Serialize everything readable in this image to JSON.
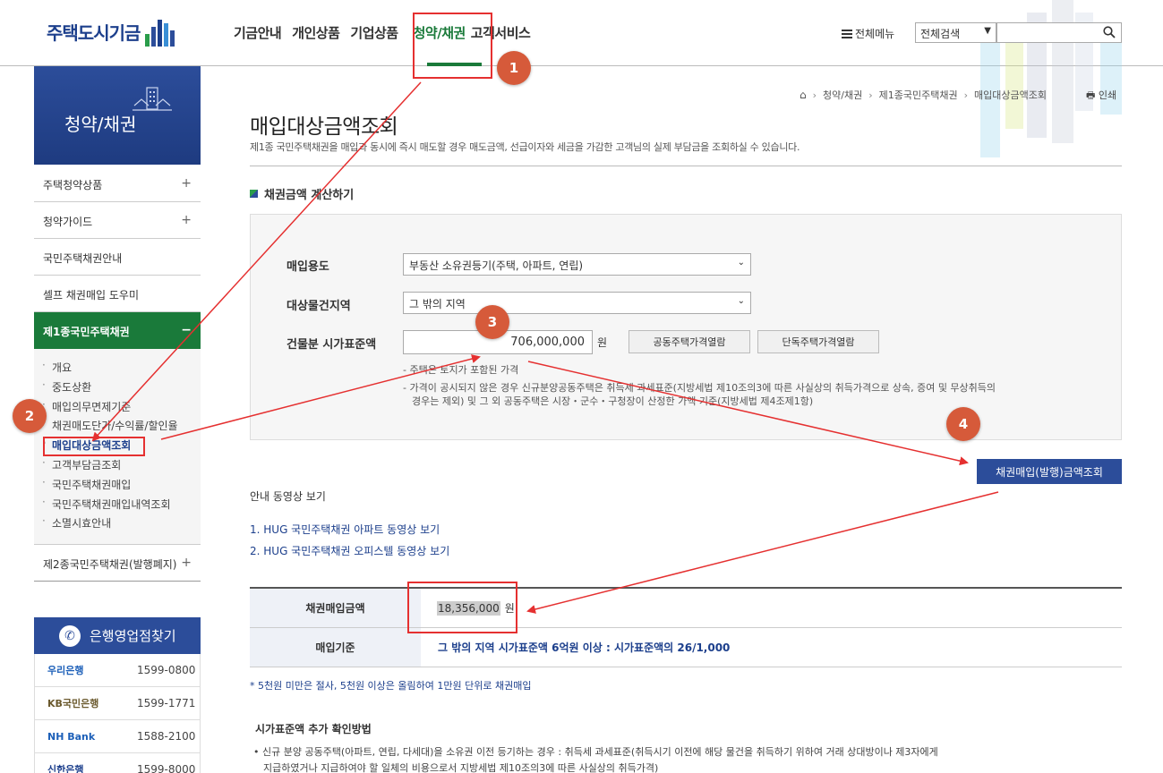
{
  "header": {
    "logo_text": "주택도시기금",
    "nav": [
      "기금안내",
      "개인상품",
      "기업상품",
      "청약/채권",
      "고객서비스"
    ],
    "all_menu_label": "전체메뉴",
    "search_scope": "전체검색",
    "search_placeholder": ""
  },
  "sidebar": {
    "title": "청약/채권",
    "items": [
      {
        "label": "주택청약상품",
        "toggle": "+"
      },
      {
        "label": "청약가이드",
        "toggle": "+"
      },
      {
        "label": "국민주택채권안내",
        "toggle": ""
      },
      {
        "label": "셀프 채권매입 도우미",
        "toggle": ""
      },
      {
        "label": "제1종국민주택채권",
        "toggle": "−"
      }
    ],
    "sub_items": [
      "개요",
      "중도상환",
      "매입의무면제기준",
      "채권매도단가/수익률/할인율",
      "매입대상금액조회",
      "고객부담금조회",
      "국민주택채권매입",
      "국민주택채권매입내역조회",
      "소멸시효안내"
    ],
    "last_item": {
      "label": "제2종국민주택채권(발행폐지)",
      "toggle": "+"
    }
  },
  "banks": {
    "title": "은행영업점찾기",
    "rows": [
      {
        "name": "우리은행",
        "tel": "1599-0800"
      },
      {
        "name": "KB국민은행",
        "tel": "1599-1771"
      },
      {
        "name": "NH Bank",
        "tel": "1588-2100"
      },
      {
        "name": "신한은행",
        "tel": "1599-8000"
      }
    ]
  },
  "breadcrumb": [
    "청약/채권",
    "제1종국민주택채권",
    "매입대상금액조회"
  ],
  "print_label": "인쇄",
  "page": {
    "title": "매입대상금액조회",
    "desc": "제1종 국민주택채권을 매입과 동시에 즉시 매도할 경우 매도금액, 선급이자와 세금을 가감한 고객님의 실제 부담금을 조회하실 수 있습니다.",
    "section_title": "채권금액 계산하기"
  },
  "form": {
    "purpose_label": "매입용도",
    "purpose_value": "부동산 소유권등기(주택, 아파트, 연립)",
    "region_label": "대상물건지역",
    "region_value": "그 밖의 지역",
    "price_label": "건물분 시가표준액",
    "price_value": "706,000,000",
    "price_unit": "원",
    "btn_apartment": "공동주택가격열람",
    "btn_house": "단독주택가격열람",
    "note1": "- 주택은 토지가 포함된 가격",
    "note2a": "- 가격이 공시되지 않은 경우 신규분양공동주택은 취득세 과세표준(지방세법 제10조의3에 따른 사실상의 취득가격으로 상속, 증여 및 무상취득의",
    "note2b": "경우는 제외) 및 그 외 공동주택은 시장・군수・구청장이 산정한 가액 기준(지방세법 제4조제1항)"
  },
  "result_button": "채권매입(발행)금액조회",
  "video": {
    "title": "안내 동영상 보기",
    "links": [
      "1. HUG 국민주택채권 아파트 동영상 보기",
      "2. HUG 국민주택채권 오피스텔 동영상 보기"
    ]
  },
  "result": {
    "amount_label": "채권매입금액",
    "amount_value": "18,356,000",
    "amount_unit": "원",
    "basis_label": "매입기준",
    "basis_value": "그 밖의 지역 시가표준액 6억원 이상 : 시가표준액의 26/1,000"
  },
  "footnote": "* 5천원 미만은 절사, 5천원 이상은 올림하여 1만원 단위로 채권매입",
  "extra": {
    "title": "시가표준액 추가 확인방법",
    "desc_line1": "• 신규 분양 공동주택(아파트, 연립, 다세대)을 소유권 이전 등기하는 경우 : 취득세 과세표준(취득시기 이전에 해당 물건을 취득하기 위하여 거래 상대방이나 제3자에게",
    "desc_line2": "지급하였거나 지급하여야 할 일체의 비용으로서 지방세법 제10조의3에 따른 사실상의 취득가격)"
  },
  "annotations": [
    "1",
    "2",
    "3",
    "4"
  ],
  "colors": {
    "primary": "#2c4d9a",
    "active_green": "#1a7a3a",
    "annotation_red": "#e53030",
    "step_circle": "#d65a3a"
  }
}
